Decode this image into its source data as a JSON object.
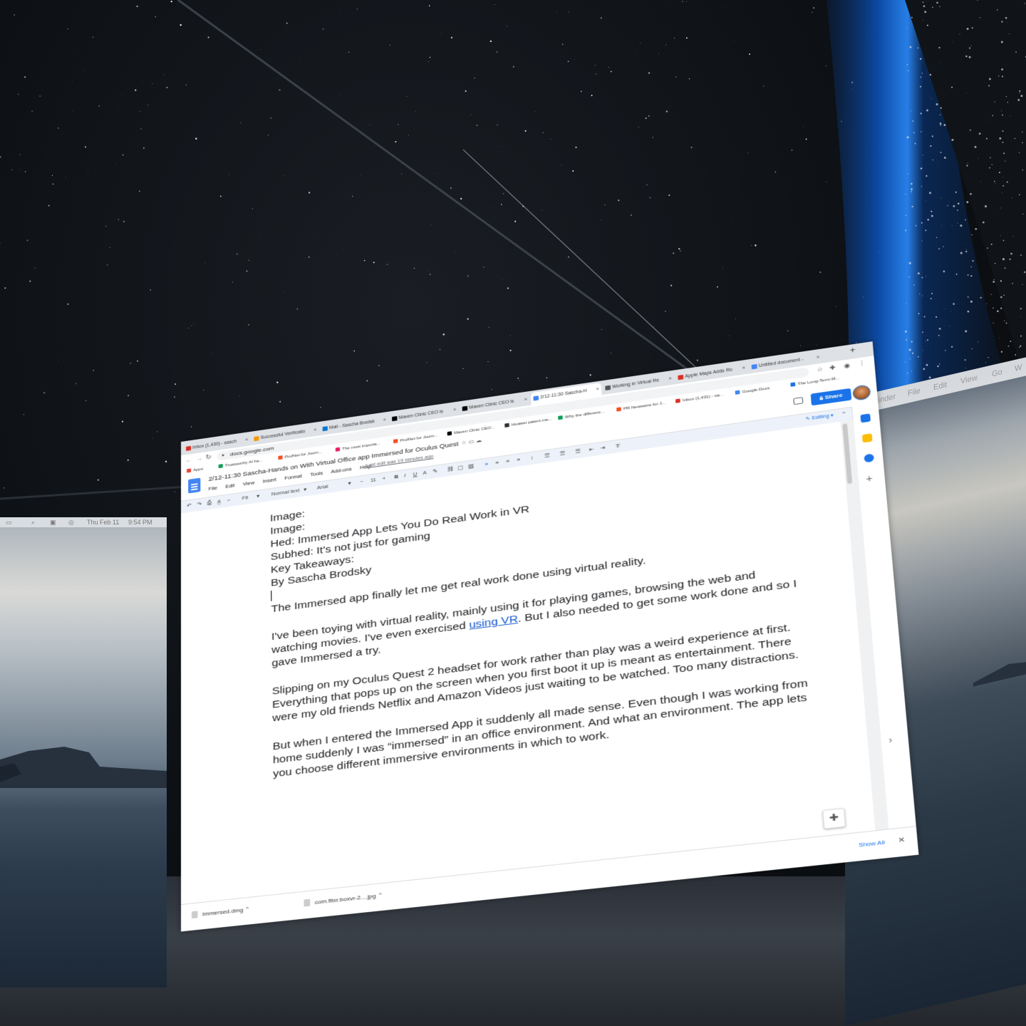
{
  "environment": {
    "left_menubar": {
      "date": "Thu Feb 11",
      "time": "9:54 PM"
    },
    "right_menubar": {
      "items": [
        "Finder",
        "File",
        "Edit",
        "View",
        "Go",
        "W"
      ]
    }
  },
  "browser": {
    "tabs": [
      {
        "label": "Inbox (1,430) - sasch",
        "color": "#d93025"
      },
      {
        "label": "Successful Verificatio",
        "color": "#f29900"
      },
      {
        "label": "Mail - Sascha Brodsk",
        "color": "#0078d4"
      },
      {
        "label": "Maven Clinic CEO is",
        "color": "#000000"
      },
      {
        "label": "Maven Clinic CEO is",
        "color": "#000000"
      },
      {
        "label": "2/12-11:30 Sascha-H",
        "color": "#4285f4"
      },
      {
        "label": "Working in Virtual Re",
        "color": "#555555"
      },
      {
        "label": "Apple Maps Adds Ro",
        "color": "#d93025"
      },
      {
        "label": "Untitled document -",
        "color": "#4285f4"
      }
    ],
    "active_tab_index": 5,
    "url": "docs.google.com",
    "bookmarks": [
      {
        "label": "Apps",
        "color": "#ea4335"
      },
      {
        "label": "Trustworthy AI ha...",
        "color": "#0f9d58"
      },
      {
        "label": "ProfNet for Journ...",
        "color": "#f4511e"
      },
      {
        "label": "The most importa...",
        "color": "#e91e63"
      },
      {
        "label": "ProfNet for Journ...",
        "color": "#f4511e"
      },
      {
        "label": "Maven Clinic CEO...",
        "color": "#000000"
      },
      {
        "label": "Huawei patent me...",
        "color": "#333333"
      },
      {
        "label": "Why the differenc...",
        "color": "#0f9d58"
      },
      {
        "label": "PR Newswire for J...",
        "color": "#f4511e"
      },
      {
        "label": "Inbox (1,431) - sa...",
        "color": "#d93025"
      },
      {
        "label": "Google Docs",
        "color": "#4285f4"
      },
      {
        "label": "The Long-Term M...",
        "color": "#1a73e8"
      }
    ]
  },
  "docs": {
    "title": "2/12-11:30 Sascha-Hands on With Virtual Office app Immersed for Oculus Quest",
    "menus": [
      "File",
      "Edit",
      "View",
      "Insert",
      "Format",
      "Tools",
      "Add-ons",
      "Help"
    ],
    "last_edit": "Last edit was 19 minutes ago",
    "share_label": "Share",
    "editing_label": "Editing",
    "format": {
      "zoom": "Fit",
      "style": "Normal text",
      "font": "Arial",
      "size": "11"
    },
    "body": {
      "l1": "Image:",
      "l2": "Image:",
      "l3": "Hed: Immersed App Lets You Do Real Work in VR",
      "l4": "Subhed: It's not just for gaming",
      "l5": "Key Takeaways:",
      "l6": "By Sascha Brodsky",
      "l7": "The Immersed app finally let me get real work done using virtual reality.",
      "p1a": "I've been toying with virtual reality, mainly using it for playing games, browsing the web and watching movies. I've even exercised ",
      "p1link": "using VR",
      "p1b": ". But I also needed to get some work done and so I gave Immersed a try.",
      "p2": "Slipping on my Oculus Quest 2 headset for work rather than play was a weird experience at first. Everything that pops up on the screen when you first boot it up is meant as entertainment. There were my old friends Netflix and Amazon Videos just waiting to be watched. Too many distractions.",
      "p3": "But when I entered the Immersed App it suddenly all made sense. Even though I was working from home suddenly I was “immersed” in an office environment. And what an environment. The app lets you choose different immersive environments in which to work."
    }
  },
  "downloads": {
    "items": [
      "Immersed.dmg",
      "com.fitxr.boxvr-2....jpg"
    ],
    "show_all": "Show All"
  }
}
